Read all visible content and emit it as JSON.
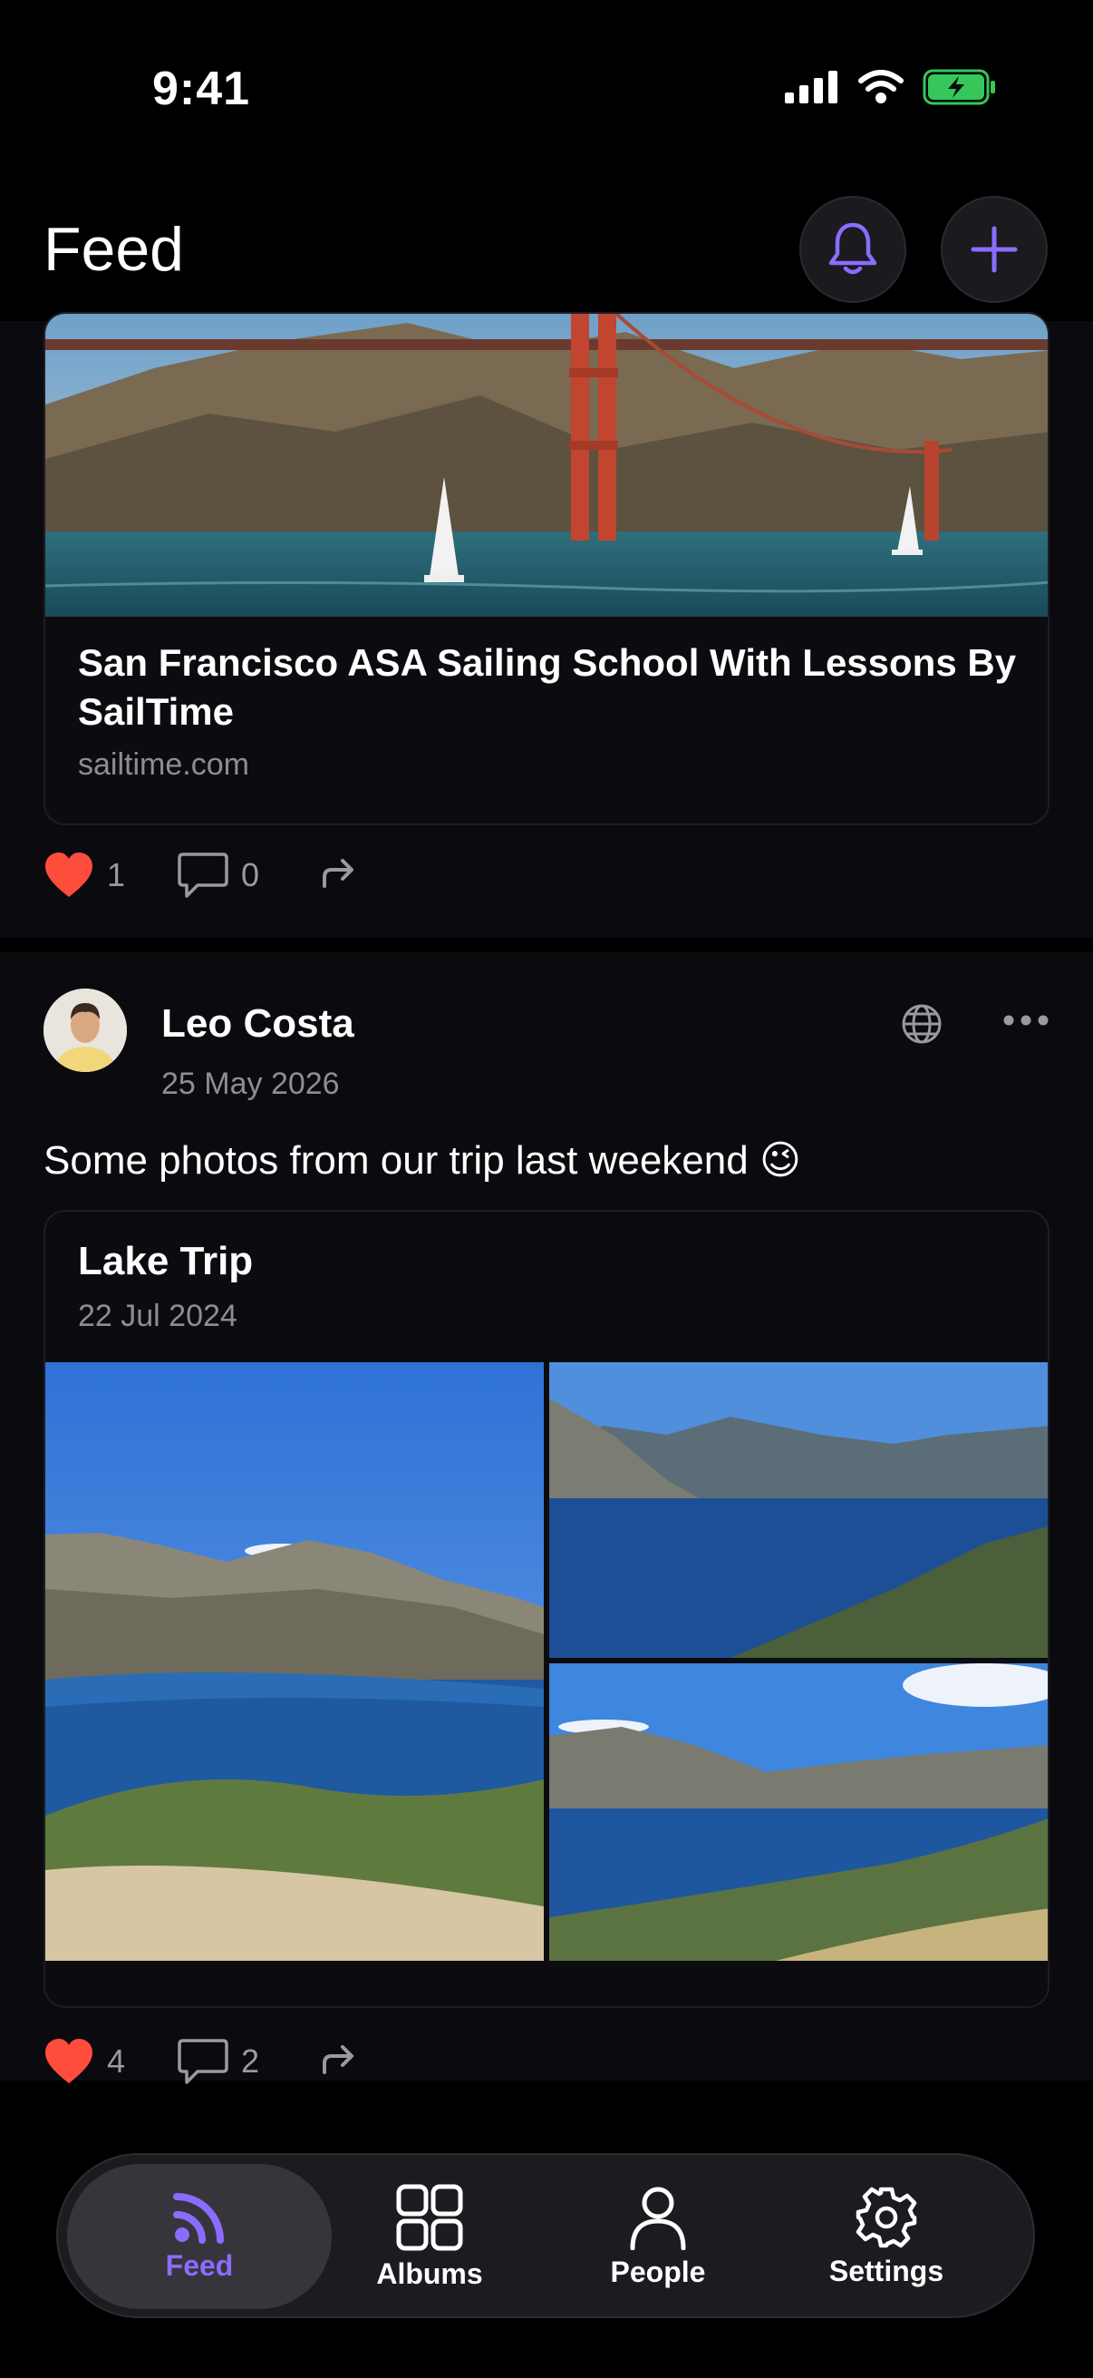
{
  "status_bar": {
    "time": "9:41"
  },
  "header": {
    "title": "Feed"
  },
  "colors": {
    "accent": "#8b6cff",
    "heart": "#ff4d3d",
    "background": "#000000",
    "card": "#0b0a0e"
  },
  "posts": [
    {
      "link": {
        "title": "San Francisco ASA Sailing School With Lessons By SailTime",
        "domain": "sailtime.com"
      },
      "likes": "1",
      "comments": "0"
    },
    {
      "author": "Leo Costa",
      "date": "25 May 2026",
      "text": "Some photos from our trip last weekend 😉",
      "album": {
        "title": "Lake Trip",
        "date": "22 Jul 2024"
      },
      "likes": "4",
      "comments": "2"
    }
  ],
  "tabs": [
    {
      "label": "Feed",
      "icon": "rss-icon"
    },
    {
      "label": "Albums",
      "icon": "grid-icon"
    },
    {
      "label": "People",
      "icon": "person-icon"
    },
    {
      "label": "Settings",
      "icon": "gear-icon"
    }
  ]
}
